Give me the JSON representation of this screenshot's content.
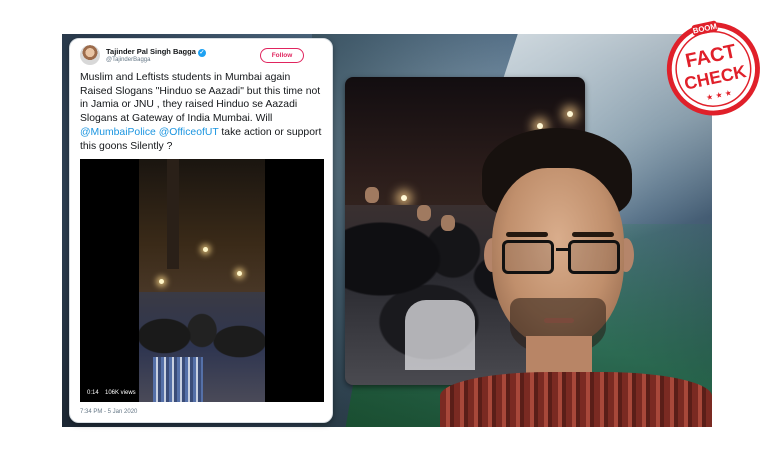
{
  "tweet": {
    "author_name": "Tajinder Pal Singh Bagga",
    "verified_mark": "✓",
    "handle": "@TajinderBagga",
    "follow_label": "Follow",
    "text_parts": [
      "Muslim and Leftists students in Mumbai again Raised Slogans \"Hinduo se Aazadi\" but this time not in Jamia or JNU , they raised Hinduo se Aazadi Slogans at Gateway of India Mumbai. Will ",
      "@MumbaiPolice",
      " ",
      "@OfficeofUT",
      " take action or support this goons Silently ?"
    ],
    "video": {
      "duration": "0:14",
      "views": "106K views"
    },
    "timestamp": "7:34 PM - 5 Jan 2020"
  },
  "stamp": {
    "brand": "BOOM",
    "line1": "FACT",
    "line2": "CHECK",
    "stars": "★ ★ ★",
    "color": "#e0202a"
  },
  "colors": {
    "mention": "#1b95e0",
    "follow_border": "#e0245e"
  }
}
